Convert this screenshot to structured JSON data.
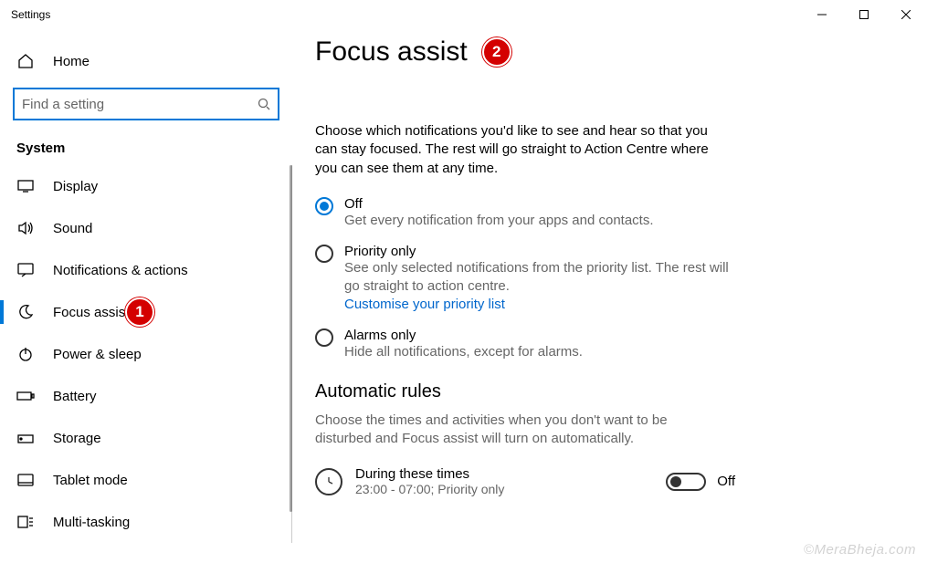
{
  "window": {
    "title": "Settings"
  },
  "sidebar": {
    "home": "Home",
    "search_placeholder": "Find a setting",
    "section": "System",
    "items": [
      {
        "label": "Display"
      },
      {
        "label": "Sound"
      },
      {
        "label": "Notifications & actions"
      },
      {
        "label": "Focus assist"
      },
      {
        "label": "Power & sleep"
      },
      {
        "label": "Battery"
      },
      {
        "label": "Storage"
      },
      {
        "label": "Tablet mode"
      },
      {
        "label": "Multi-tasking"
      }
    ]
  },
  "main": {
    "title": "Focus assist",
    "desc": "Choose which notifications you'd like to see and hear so that you can stay focused. The rest will go straight to Action Centre where you can see them at any time.",
    "options": [
      {
        "label": "Off",
        "sub": "Get every notification from your apps and contacts.",
        "checked": true
      },
      {
        "label": "Priority only",
        "sub": "See only selected notifications from the priority list. The rest will go straight to action centre.",
        "link": "Customise your priority list"
      },
      {
        "label": "Alarms only",
        "sub": "Hide all notifications, except for alarms."
      }
    ],
    "rules_heading": "Automatic rules",
    "rules_desc": "Choose the times and activities when you don't want to be disturbed and Focus assist will turn on automatically.",
    "rule": {
      "title": "During these times",
      "sub": "23:00 - 07:00; Priority only",
      "state": "Off"
    }
  },
  "annotations": {
    "badge1": "1",
    "badge2": "2"
  },
  "watermark": "©MeraBheja.com"
}
